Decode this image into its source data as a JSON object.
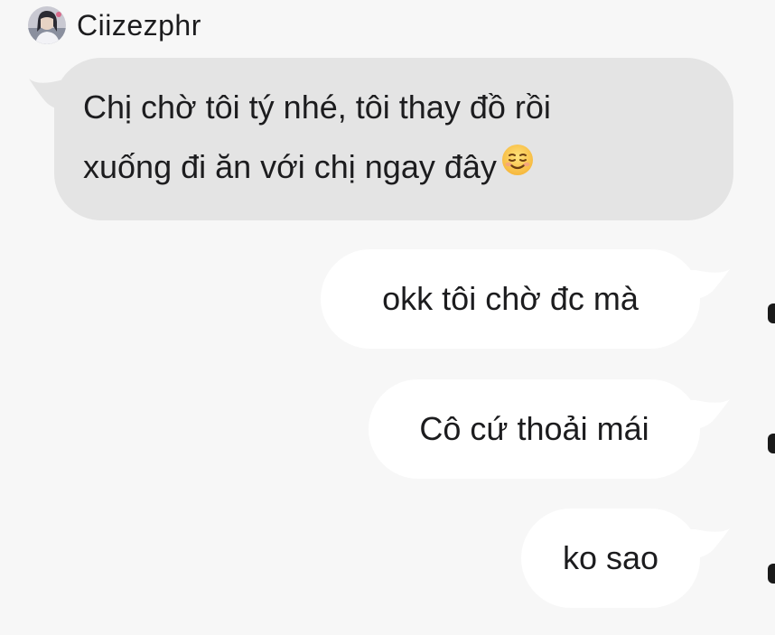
{
  "conversation": {
    "sender": {
      "name": "Ciizezphr",
      "avatar_icon": "avatar-photo"
    },
    "messages": [
      {
        "direction": "incoming",
        "lines": [
          "Chị chờ tôi tý nhé, tôi thay đồ rồi",
          "xuống đi ăn với chị ngay đây"
        ],
        "emoji": "smiling-face-icon",
        "bubble_color": "#e4e4e4"
      },
      {
        "direction": "outgoing",
        "text": "okk tôi chờ đc mà",
        "bubble_color": "#ffffff"
      },
      {
        "direction": "outgoing",
        "text": "Cô cứ thoải mái",
        "bubble_color": "#ffffff"
      },
      {
        "direction": "outgoing",
        "text": "ko sao",
        "bubble_color": "#ffffff"
      }
    ]
  },
  "colors": {
    "background": "#f7f7f7",
    "incoming_bubble": "#e4e4e4",
    "outgoing_bubble": "#ffffff",
    "text": "#1c1c1e"
  }
}
